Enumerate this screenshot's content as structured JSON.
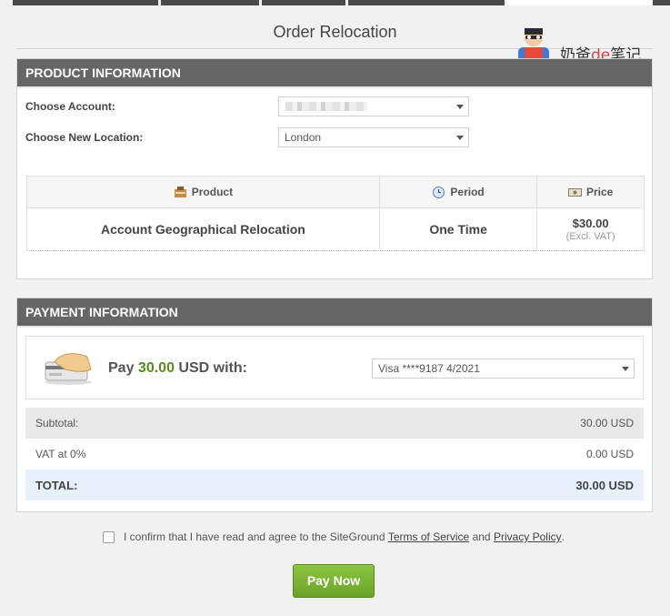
{
  "page": {
    "title": "Order Relocation"
  },
  "watermark": {
    "prefix": "奶爸",
    "mid": "de",
    "suffix": "笔记"
  },
  "product_info": {
    "heading": "PRODUCT INFORMATION",
    "account_label": "Choose Account:",
    "account_value": "",
    "location_label": "Choose New Location:",
    "location_value": "London",
    "table": {
      "headers": {
        "product": "Product",
        "period": "Period",
        "price": "Price"
      },
      "row": {
        "product": "Account Geographical Relocation",
        "period": "One Time",
        "price": "$30.00",
        "price_note": "(Excl. VAT)"
      }
    }
  },
  "payment_info": {
    "heading": "PAYMENT INFORMATION",
    "pay_prefix": "Pay",
    "pay_amount": "30.00",
    "pay_suffix": "USD with:",
    "card_value": "Visa ****9187 4/2021",
    "subtotal_label": "Subtotal:",
    "subtotal_value": "30.00 USD",
    "vat_label": "VAT at 0%",
    "vat_value": "0.00 USD",
    "total_label": "TOTAL:",
    "total_value": "30.00 USD"
  },
  "confirm": {
    "text_before": "I confirm that I have read and agree to the SiteGround",
    "tos_link": "Terms of Service",
    "and": "and",
    "privacy_link": "Privacy Policy",
    "end": "."
  },
  "pay_button": {
    "label": "Pay Now"
  },
  "colors": {
    "header_bg": "#666666",
    "accent_green": "#6aa329",
    "amount_green": "#5a8a1e",
    "total_bg": "#e6f1fc"
  },
  "icons": [
    "product-icon",
    "clock-icon",
    "price-icon",
    "credit-card-icon",
    "mascot-icon",
    "chevron-down-icon"
  ]
}
